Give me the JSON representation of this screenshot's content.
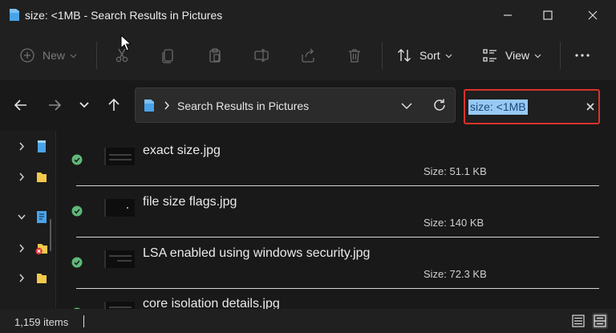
{
  "window": {
    "title": "size: <1MB - Search Results in Pictures",
    "icons": {
      "app": "folder-icon",
      "minimize": "minimize-icon",
      "maximize": "maximize-icon",
      "close": "close-icon"
    }
  },
  "toolbar": {
    "new_label": "New",
    "sort_label": "Sort",
    "view_label": "View",
    "icons": [
      "plus-circle-icon",
      "cut-icon",
      "copy-icon",
      "paste-icon",
      "rename-icon",
      "share-icon",
      "delete-icon",
      "sort-icon",
      "view-icon",
      "more-icon"
    ]
  },
  "navigation": {
    "icons": [
      "back-arrow-icon",
      "forward-arrow-icon",
      "recent-chevron-icon",
      "up-arrow-icon"
    ]
  },
  "address": {
    "path": "Search Results in Pictures",
    "icons": {
      "location": "folder-icon",
      "separator": "chevron-right-icon",
      "dropdown": "chevron-down-icon",
      "refresh": "refresh-icon"
    }
  },
  "search": {
    "query": "size: <1MB",
    "icons": {
      "clear": "clear-icon"
    }
  },
  "nav_pane": {
    "items": [
      {
        "icon": "blue-folder-icon",
        "expanded": false
      },
      {
        "icon": "yellow-folder-icon",
        "expanded": false
      },
      {
        "icon": "document-icon",
        "expanded": true
      },
      {
        "icon": "folder-error-icon",
        "expanded": false
      },
      {
        "icon": "yellow-folder-icon",
        "expanded": false
      }
    ]
  },
  "files": [
    {
      "name": "exact size.jpg",
      "size": "Size: 51.1 KB",
      "status": "synced-check-icon"
    },
    {
      "name": "file size flags.jpg",
      "size": "Size: 140 KB",
      "status": "synced-check-icon"
    },
    {
      "name": "LSA enabled using windows security.jpg",
      "size": "Size: 72.3 KB",
      "status": "synced-check-icon"
    },
    {
      "name": "core isolation details.jpg",
      "size": "",
      "status": "synced-check-icon"
    }
  ],
  "status": {
    "item_count": "1,159 items",
    "icons": {
      "details_view": "details-view-icon",
      "tiles_view": "tiles-view-icon"
    }
  },
  "colors": {
    "accent": "#97c9f4",
    "highlight_box": "#d9322c",
    "sync_check": "#5fb878",
    "folder_blue": "#4aa3e8",
    "folder_yellow": "#f2c94c"
  }
}
